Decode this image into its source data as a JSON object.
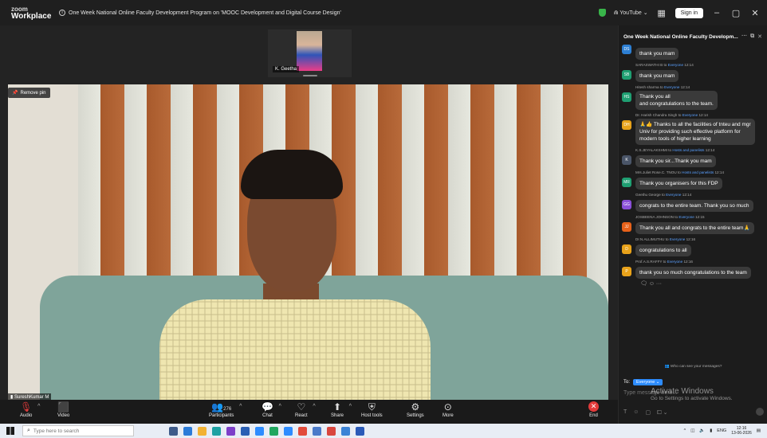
{
  "titlebar": {
    "logo_top": "zoom",
    "logo_bottom": "Workplace",
    "meeting_title": "One Week National Online Faculty Development Program on 'MOOC Development and Digital Course Design'",
    "youtube_label": "YouTube",
    "sign_in": "Sign in"
  },
  "stage": {
    "thumbnail_name": "K. Geetha",
    "remove_pin": "Remove pin",
    "speaker_name": "SureshKumar M"
  },
  "toolbar": {
    "audio": "Audio",
    "video": "Video",
    "participants": "Participants",
    "participants_count": "276",
    "chat": "Chat",
    "react": "React",
    "share": "Share",
    "host_tools": "Host tools",
    "settings": "Settings",
    "more": "More",
    "end": "End"
  },
  "chat": {
    "title": "One Week National Online Faculty Developm...",
    "messages": [
      {
        "initials": "DS",
        "color": "#2d7fd3",
        "sender": "",
        "to": "",
        "time": "",
        "text": "thank you mam"
      },
      {
        "initials": "SB",
        "color": "#1f9f72",
        "sender": "SARASWATHI B",
        "to": "Everyone",
        "time": "12:14",
        "text": "thank you mam"
      },
      {
        "initials": "HS",
        "color": "#1f9f72",
        "sender": "Hitesh sharma",
        "to": "Everyone",
        "time": "12:14",
        "text": "Thank you all\nand congratulations to the team."
      },
      {
        "initials": "DH",
        "color": "#e8a21a",
        "sender": "Dr. Harish Chandra Singh",
        "to": "Everyone",
        "time": "12:14",
        "text": "🙏👍 Thanks to all the facilities of tnteu and mgr Univ for providing such effective platform for modern tools of higher learning"
      },
      {
        "initials": "K",
        "color": "#4a5568",
        "sender": "K.S.JEYALAKSHMI",
        "to": "Hosts and panelists",
        "time": "12:14",
        "text": "Thank you sir...Thank you mam"
      },
      {
        "initials": "MR",
        "color": "#1f9f72",
        "sender": "Mrs.Juliet Rose.C. TNOU",
        "to": "Hosts and panelists",
        "time": "12:14",
        "text": "Thank you organisers for this FDP"
      },
      {
        "initials": "GG",
        "color": "#8a4fd8",
        "sender": "Geethu George",
        "to": "Everyone",
        "time": "12:14",
        "text": "congrats to the entire team. Thank you so much"
      },
      {
        "initials": "JJ",
        "color": "#e8621a",
        "sender": "JOSBEENA JOHNSON",
        "to": "Everyone",
        "time": "12:15",
        "text": "Thank you all and congrats to the entire team🙏"
      },
      {
        "initials": "D",
        "color": "#e8a21a",
        "sender": "Dr.N.ALLIMUTHU",
        "to": "Everyone",
        "time": "12:16",
        "text": "congratulations to all"
      },
      {
        "initials": "P",
        "color": "#e8a21a",
        "sender": "Prof.A.S.RAFFY",
        "to": "Everyone",
        "time": "12:16",
        "text": "thank you so much congratulations to the team"
      }
    ],
    "who_can_see": "Who can see your messages?",
    "to_label": "To:",
    "to_value": "Everyone",
    "input_placeholder": "Type message here...",
    "watermark_title": "Activate Windows",
    "watermark_sub": "Go to Settings to activate Windows."
  },
  "taskbar": {
    "search_placeholder": "Type here to search",
    "lang": "ENG",
    "time": "12:16",
    "date": "13-06-2026"
  }
}
